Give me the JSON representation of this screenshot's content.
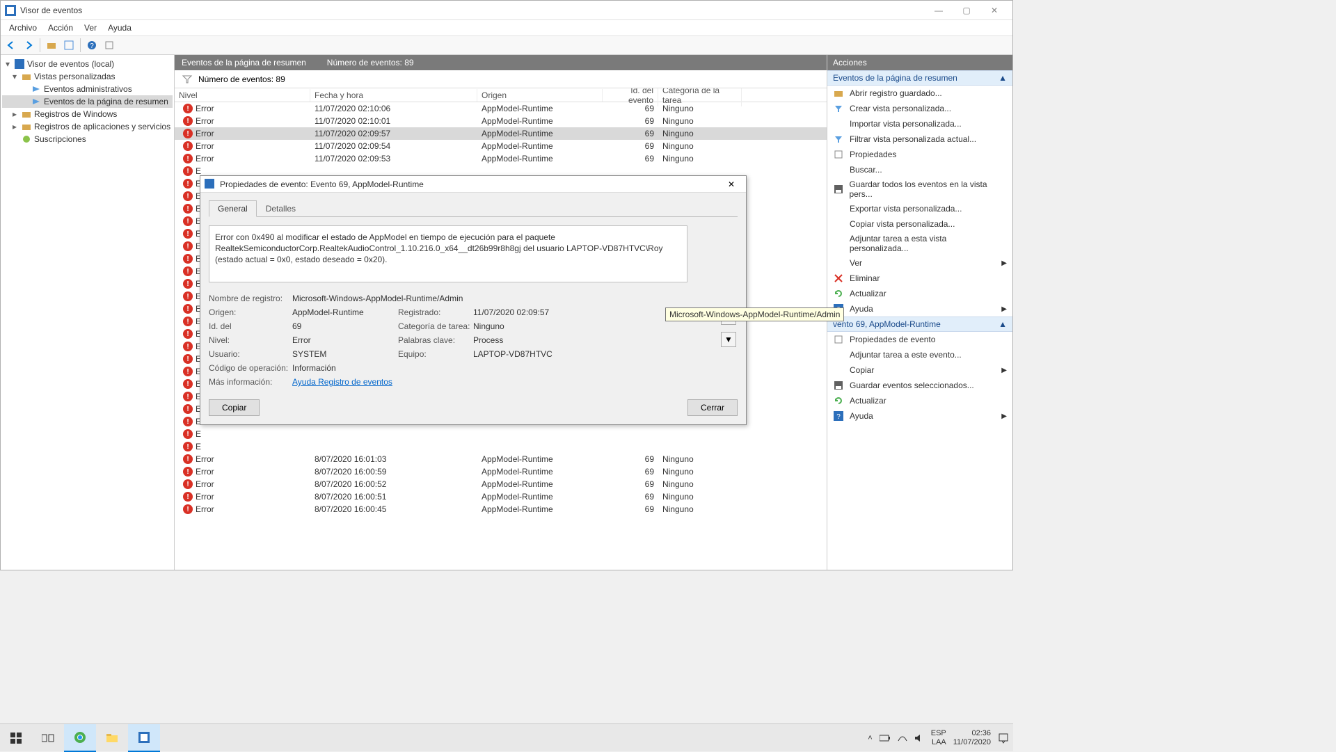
{
  "app": {
    "title": "Visor de eventos"
  },
  "menu": [
    "Archivo",
    "Acción",
    "Ver",
    "Ayuda"
  ],
  "tree": {
    "root": "Visor de eventos (local)",
    "custom_views": "Vistas personalizadas",
    "admin_events": "Eventos administrativos",
    "summary_events": "Eventos de la página de resumen",
    "win_logs": "Registros de Windows",
    "app_logs": "Registros de aplicaciones y servicios",
    "subs": "Suscripciones"
  },
  "main": {
    "header_title": "Eventos de la página de resumen",
    "header_count": "Número de eventos: 89",
    "filter_count": "Número de eventos: 89",
    "columns": {
      "level": "Nivel",
      "date": "Fecha y hora",
      "origin": "Origen",
      "id": "Id. del evento",
      "cat": "Categoría de la tarea"
    },
    "rows_top": [
      {
        "level": "Error",
        "date": "11/07/2020 02:10:06",
        "origin": "AppModel-Runtime",
        "id": "69",
        "cat": "Ninguno"
      },
      {
        "level": "Error",
        "date": "11/07/2020 02:10:01",
        "origin": "AppModel-Runtime",
        "id": "69",
        "cat": "Ninguno"
      },
      {
        "level": "Error",
        "date": "11/07/2020 02:09:57",
        "origin": "AppModel-Runtime",
        "id": "69",
        "cat": "Ninguno",
        "selected": true
      },
      {
        "level": "Error",
        "date": "11/07/2020 02:09:54",
        "origin": "AppModel-Runtime",
        "id": "69",
        "cat": "Ninguno"
      },
      {
        "level": "Error",
        "date": "11/07/2020 02:09:53",
        "origin": "AppModel-Runtime",
        "id": "69",
        "cat": "Ninguno"
      }
    ],
    "rows_bottom": [
      {
        "level": "Error",
        "date": "8/07/2020 16:01:03",
        "origin": "AppModel-Runtime",
        "id": "69",
        "cat": "Ninguno"
      },
      {
        "level": "Error",
        "date": "8/07/2020 16:00:59",
        "origin": "AppModel-Runtime",
        "id": "69",
        "cat": "Ninguno"
      },
      {
        "level": "Error",
        "date": "8/07/2020 16:00:52",
        "origin": "AppModel-Runtime",
        "id": "69",
        "cat": "Ninguno"
      },
      {
        "level": "Error",
        "date": "8/07/2020 16:00:51",
        "origin": "AppModel-Runtime",
        "id": "69",
        "cat": "Ninguno"
      },
      {
        "level": "Error",
        "date": "8/07/2020 16:00:45",
        "origin": "AppModel-Runtime",
        "id": "69",
        "cat": "Ninguno"
      }
    ]
  },
  "actions": {
    "title": "Acciones",
    "section1": "Eventos de la página de resumen",
    "items1": [
      "Abrir registro guardado...",
      "Crear vista personalizada...",
      "Importar vista personalizada...",
      "Filtrar vista personalizada actual...",
      "Propiedades",
      "Buscar...",
      "Guardar todos los eventos en la vista pers...",
      "Exportar vista personalizada...",
      "Copiar vista personalizada...",
      "Adjuntar tarea a esta vista personalizada...",
      "Ver",
      "Eliminar",
      "Actualizar",
      "Ayuda"
    ],
    "section2": "vento 69, AppModel-Runtime",
    "items2": [
      "Propiedades de evento",
      "Adjuntar tarea a este evento...",
      "Copiar",
      "Guardar eventos seleccionados...",
      "Actualizar",
      "Ayuda"
    ]
  },
  "dialog": {
    "title": "Propiedades de evento: Evento 69, AppModel-Runtime",
    "tab_general": "General",
    "tab_details": "Detalles",
    "message": "Error con 0x490 al modificar el estado de AppModel en tiempo de ejecución para el paquete RealtekSemiconductorCorp.RealtekAudioControl_1.10.216.0_x64__dt26b99r8h8gj del usuario LAPTOP-VD87HTVC\\Roy (estado actual = 0x0, estado deseado = 0x20).",
    "labels": {
      "logname": "Nombre de registro:",
      "origin": "Origen:",
      "id": "Id. del",
      "level": "Nivel:",
      "user": "Usuario:",
      "opcode": "Código de operación:",
      "moreinfo": "Más información:",
      "registered": "Registrado:",
      "taskcat": "Categoría de tarea:",
      "keywords": "Palabras clave:",
      "computer": "Equipo:"
    },
    "values": {
      "logname": "Microsoft-Windows-AppModel-Runtime/Admin",
      "origin": "AppModel-Runtime",
      "id": "69",
      "level": "Error",
      "user": "SYSTEM",
      "opcode": "Información",
      "moreinfo": "Ayuda Registro de eventos",
      "registered": "11/07/2020 02:09:57",
      "taskcat": "Ninguno",
      "keywords": "Process",
      "computer": "LAPTOP-VD87HTVC"
    },
    "copy_btn": "Copiar",
    "close_btn": "Cerrar"
  },
  "tooltip": "Microsoft-Windows-AppModel-Runtime/Admin",
  "taskbar": {
    "lang1": "ESP",
    "lang2": "LAA",
    "time": "02:36",
    "date": "11/07/2020"
  }
}
